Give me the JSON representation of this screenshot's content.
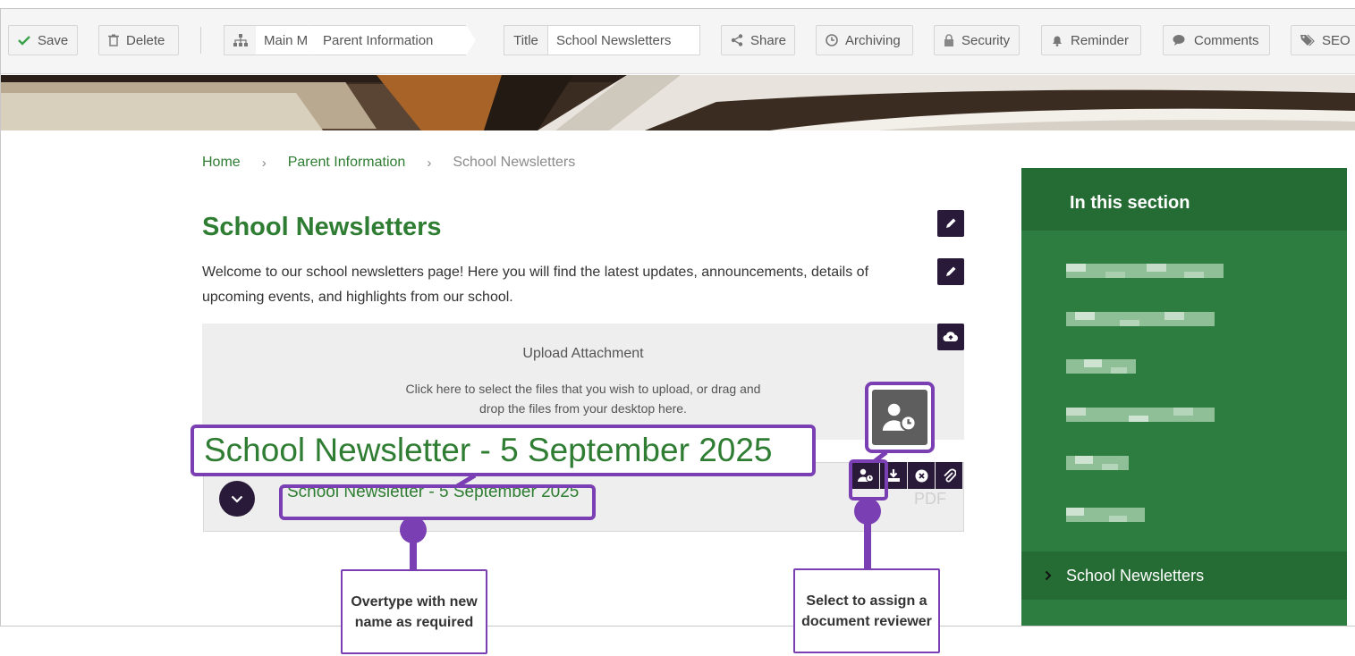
{
  "toolbar": {
    "save": "Save",
    "delete": "Delete",
    "breadcrumb": [
      "Main M",
      "Parent Information"
    ],
    "title_label": "Title",
    "title_value": "School Newsletters",
    "share": "Share",
    "archiving": "Archiving",
    "security": "Security",
    "reminder": "Reminder",
    "comments": "Comments",
    "seo": "SEO"
  },
  "breadcrumb": {
    "home": "Home",
    "parent": "Parent Information",
    "current": "School Newsletters",
    "separator": "›"
  },
  "page": {
    "title": "School Newsletters",
    "intro": "Welcome to our school newsletters page! Here you will find the latest updates, announcements, details of upcoming events, and highlights from our school."
  },
  "upload": {
    "title": "Upload Attachment",
    "text": "Click here to select the files that you wish to upload, or drag and drop the files from your desktop here."
  },
  "document": {
    "name": "School Newsletter - 5 September 2025",
    "type": "PDF"
  },
  "callouts": {
    "rename": "Overtype with new name as required",
    "reviewer": "Select to assign a document reviewer"
  },
  "sidebar": {
    "heading": "In this section",
    "current": "School Newsletters"
  },
  "colors": {
    "brand_green": "#2e7d32",
    "sidebar_green": "#2e7d40",
    "dark_purple": "#2a1a3a",
    "callout_purple": "#7a3fb3"
  }
}
